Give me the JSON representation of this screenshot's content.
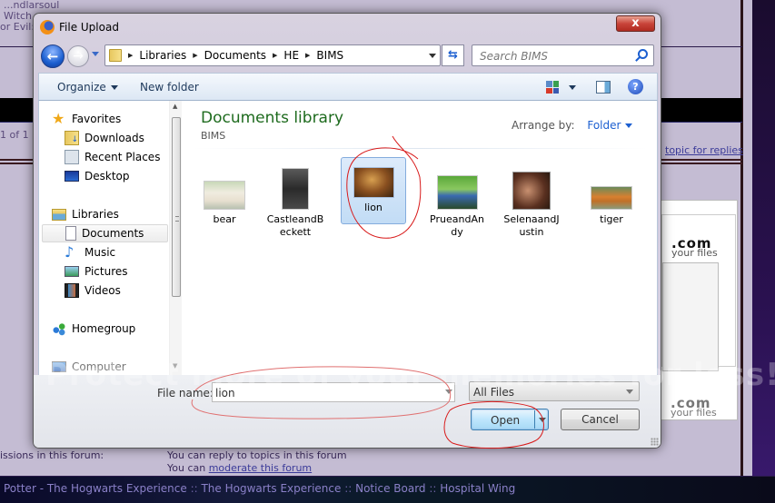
{
  "background": {
    "left_text_lines": [
      "...ndlarsoul",
      "Witch",
      "or Evil:"
    ],
    "page_of": "1 of 1",
    "replies_link": "topic for replies",
    "nav_arrows": [
      "left-arrow-icon",
      "right-arrow-icon",
      "up-arrow-icon"
    ],
    "ad": {
      "logo": ".com",
      "tagline": "your files",
      "logo2": ".com",
      "tagline2": "your files"
    },
    "watermark": "Protect more of your memories for less!",
    "permissions_label": "issions in this forum:",
    "permissions": {
      "line1": "You can reply to topics in this forum",
      "line2_prefix": "You can ",
      "line2_link": "moderate this forum"
    },
    "footer_breadcrumb": [
      "Potter - The Hogwarts Experience",
      "The Hogwarts Experience",
      "Notice Board",
      "Hospital Wing"
    ],
    "footer_sep": " :: "
  },
  "dialog": {
    "title": "File Upload",
    "close_label": "x",
    "address": {
      "crumbs": [
        "Libraries",
        "Documents",
        "HE",
        "BIMS"
      ]
    },
    "search": {
      "placeholder": "Search BIMS"
    },
    "toolbar": {
      "organize": "Organize",
      "new_folder": "New folder"
    },
    "nav": {
      "items": [
        {
          "label": "Favorites",
          "icon": "star-icon",
          "level": 0
        },
        {
          "label": "Downloads",
          "icon": "downloads-folder-icon",
          "level": 1
        },
        {
          "label": "Recent Places",
          "icon": "recent-places-icon",
          "level": 1
        },
        {
          "label": "Desktop",
          "icon": "desktop-icon",
          "level": 1
        },
        {
          "label": "Libraries",
          "icon": "libraries-icon",
          "level": 0
        },
        {
          "label": "Documents",
          "icon": "document-icon",
          "level": 1,
          "selected": true
        },
        {
          "label": "Music",
          "icon": "music-note-icon",
          "level": 1
        },
        {
          "label": "Pictures",
          "icon": "pictures-icon",
          "level": 1
        },
        {
          "label": "Videos",
          "icon": "film-icon",
          "level": 1
        },
        {
          "label": "Homegroup",
          "icon": "homegroup-icon",
          "level": 0
        },
        {
          "label": "Computer",
          "icon": "computer-icon",
          "level": 0
        }
      ]
    },
    "library": {
      "title": "Documents library",
      "subtitle": "BIMS",
      "arrange_label": "Arrange by:",
      "arrange_value": "Folder"
    },
    "files": [
      {
        "name": "bear",
        "display": "bear"
      },
      {
        "name": "CastleandBeckett",
        "display_l1": "CastleandB",
        "display_l2": "eckett"
      },
      {
        "name": "lion",
        "display": "lion",
        "selected": true
      },
      {
        "name": "PrueandAndy",
        "display_l1": "PrueandAn",
        "display_l2": "dy"
      },
      {
        "name": "SelenaandJustin",
        "display_l1": "SelenaandJ",
        "display_l2": "ustin"
      },
      {
        "name": "tiger",
        "display": "tiger"
      }
    ],
    "bottom": {
      "file_name_label": "File name:",
      "file_name_value": "lion",
      "file_type": "All Files",
      "open": "Open",
      "cancel": "Cancel"
    }
  },
  "colors": {
    "library_title": "#1e6b1e",
    "link_blue": "#1c5fd0",
    "annotation_red": "#d81a1a",
    "forum_bg": "#c4bcd3"
  }
}
